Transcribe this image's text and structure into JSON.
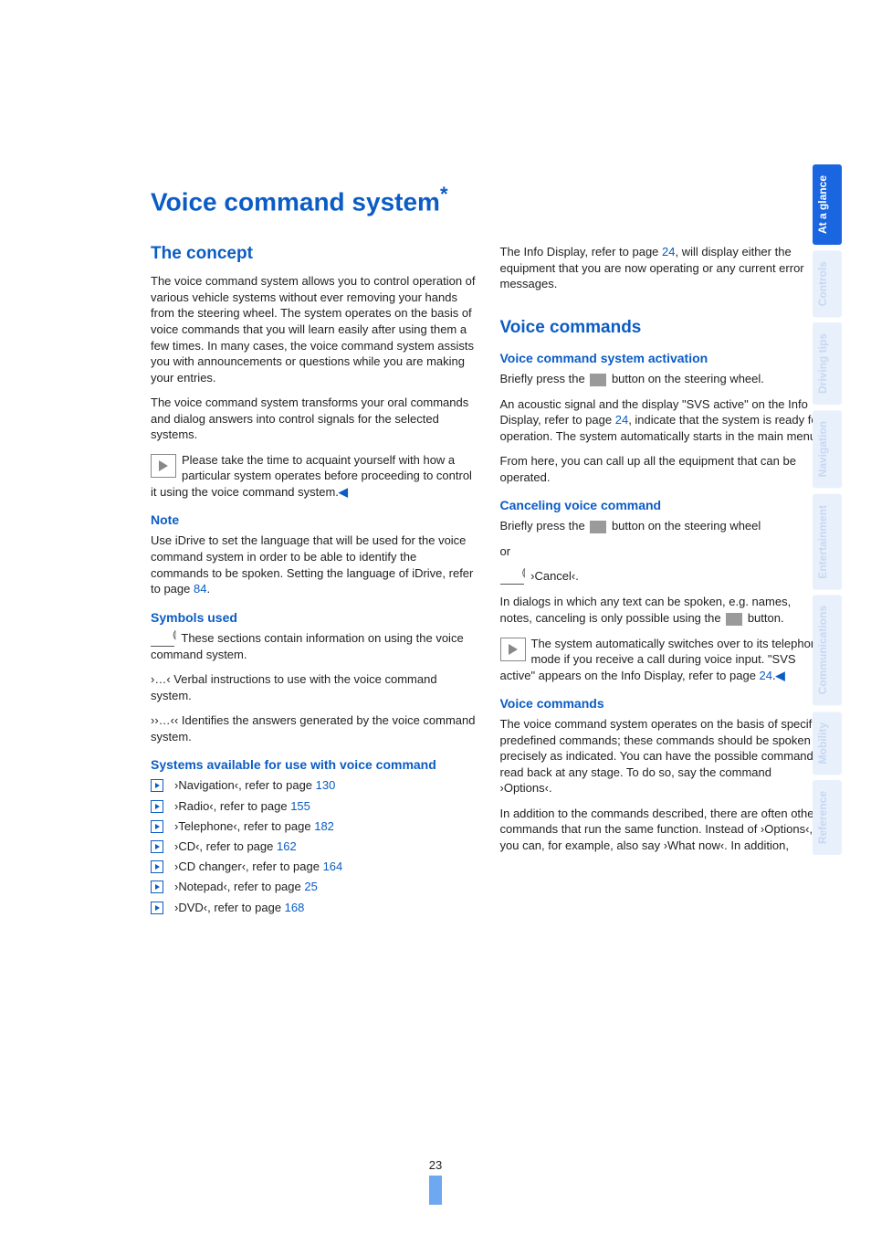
{
  "title": "Voice command system",
  "title_star": "*",
  "heading_concept": "The concept",
  "concept_p1": "The voice command system allows you to control operation of various vehicle systems without ever removing your hands from the steering wheel. The system operates on the basis of voice commands that you will learn easily after using them a few times. In many cases, the voice command system assists you with announcements or questions while you are making your entries.",
  "concept_p2": "The voice command system transforms your oral commands and dialog answers into control signals for the selected systems.",
  "concept_note": "Please take the time to acquaint yourself with how a particular system operates before proceeding to control it using the voice command system.",
  "end_tri": "◀",
  "heading_note": "Note",
  "note_p1_a": "Use iDrive to set the language that will be used for the voice command system in order to be able to identify the commands to be spoken. Setting the language of iDrive, refer to page ",
  "note_p1_pg": "84",
  "note_p1_b": ".",
  "heading_symbols": "Symbols used",
  "symbols_p1": "These sections contain information on using the voice command system.",
  "symbols_p2": "›…‹ Verbal instructions to use with the voice command system.",
  "symbols_p3": "››…‹‹ Identifies the answers generated by the voice command system.",
  "heading_systems": "Systems available for use with voice command",
  "systems": [
    {
      "label": "›Navigation‹, refer to page ",
      "page": "130"
    },
    {
      "label": "›Radio‹, refer to page ",
      "page": "155"
    },
    {
      "label": "›Telephone‹, refer to page ",
      "page": "182"
    },
    {
      "label": "›CD‹, refer to page ",
      "page": "162"
    },
    {
      "label": "›CD changer‹, refer to page ",
      "page": "164"
    },
    {
      "label": "›Notepad‹, refer to page ",
      "page": "25"
    },
    {
      "label": "›DVD‹, refer to page ",
      "page": "168"
    }
  ],
  "r_info_a": "The Info Display, refer to page ",
  "r_info_pg": "24",
  "r_info_b": ", will display either the equipment that you are now operating or any current error messages.",
  "heading_voice_commands": "Voice commands",
  "heading_activation": "Voice command system activation",
  "activation_p1a": "Briefly press the ",
  "activation_p1b": " button on the steering wheel.",
  "activation_p2a": "An acoustic signal and the display \"SVS active\" on the Info Display, refer to page ",
  "activation_p2pg": "24",
  "activation_p2b": ", indicate that the system is ready for operation. The system automatically starts in the main menu.",
  "activation_p3": "From here, you can call up all the equipment that can be operated.",
  "heading_cancel": "Canceling voice command",
  "cancel_p1a": "Briefly press the ",
  "cancel_p1b": " button on the steering wheel",
  "cancel_or": "or",
  "cancel_cmd": "›Cancel‹.",
  "cancel_p2a": "In dialogs in which any text can be spoken, e.g. names, notes, canceling is only possible using the ",
  "cancel_p2b": " button.",
  "cancel_note_a": "The system automatically switches over to its telephone mode if you receive a call during voice input. \"SVS active\" appears on the Info Display, refer to page ",
  "cancel_note_pg": "24",
  "cancel_note_b": ".",
  "heading_vc2": "Voice commands",
  "vc2_p1": "The voice command system operates on the basis of specific, predefined commands; these commands should be spoken precisely as indicated. You can have the possible commands read back at any stage. To do so, say the command ›Options‹.",
  "vc2_p2": "In addition to the commands described, there are often other commands that run the same function. Instead of ›Options‹, you can, for example, also say ›What now‹. In addition,",
  "page_number": "23",
  "tabs": [
    {
      "label": "At a glance",
      "active": true
    },
    {
      "label": "Controls",
      "active": false
    },
    {
      "label": "Driving tips",
      "active": false
    },
    {
      "label": "Navigation",
      "active": false
    },
    {
      "label": "Entertainment",
      "active": false
    },
    {
      "label": "Communications",
      "active": false
    },
    {
      "label": "Mobility",
      "active": false
    },
    {
      "label": "Reference",
      "active": false
    }
  ]
}
